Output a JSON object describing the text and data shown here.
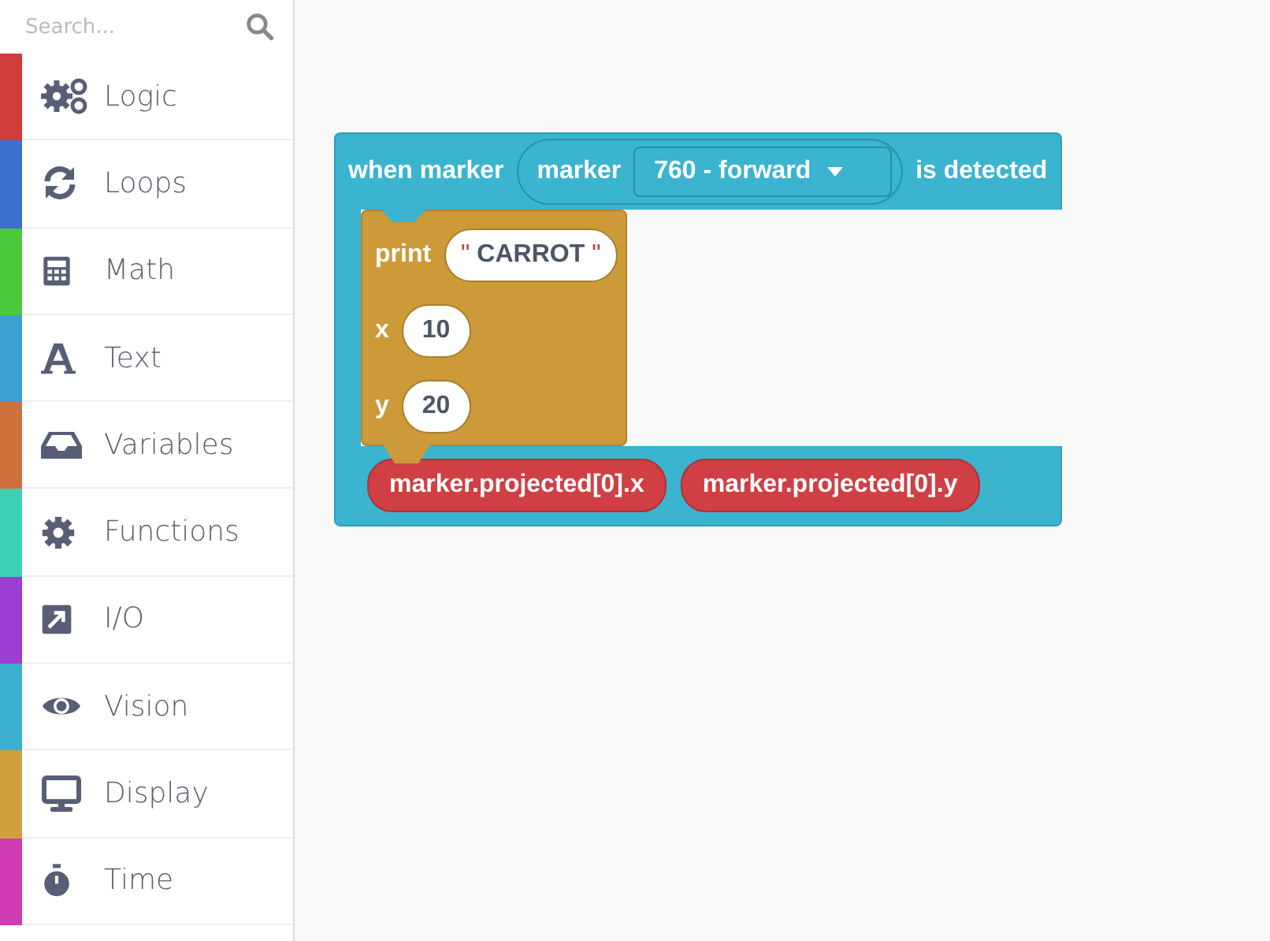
{
  "search": {
    "placeholder": "Search..."
  },
  "categories": [
    {
      "label": "Logic",
      "color": "#d03c3c"
    },
    {
      "label": "Loops",
      "color": "#3c6fd0"
    },
    {
      "label": "Math",
      "color": "#4cc93c"
    },
    {
      "label": "Text",
      "color": "#3ca0d0"
    },
    {
      "label": "Variables",
      "color": "#d0703c"
    },
    {
      "label": "Functions",
      "color": "#3cd0b4"
    },
    {
      "label": "I/O",
      "color": "#9c3cd0"
    },
    {
      "label": "Vision",
      "color": "#3cb0d0"
    },
    {
      "label": "Display",
      "color": "#d0a03c"
    },
    {
      "label": "Time",
      "color": "#d03cb4"
    }
  ],
  "event_block": {
    "label": "when marker",
    "marker_label": "marker",
    "dropdown": "760 - forward",
    "suffix": "is detected",
    "statement": {
      "label": "print",
      "open_quote": "\"",
      "value": "CARROT",
      "close_quote": "\"",
      "args": [
        {
          "label": "x",
          "value": "10"
        },
        {
          "label": "y",
          "value": "20"
        }
      ]
    },
    "reporters": [
      "marker.projected[0].x",
      "marker.projected[0].y"
    ]
  }
}
